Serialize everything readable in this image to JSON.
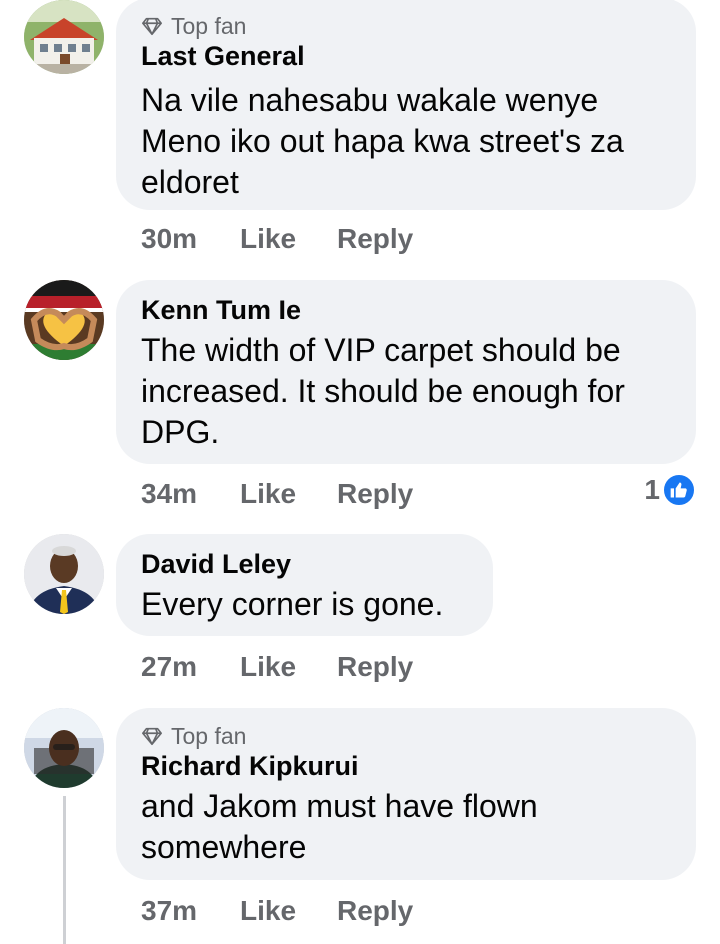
{
  "comments": [
    {
      "badge": "Top fan",
      "author": "Last General",
      "lines": [
        "Na vile nahesabu wakale wenye",
        "Meno iko out hapa kwa street's za",
        "eldoret"
      ],
      "time": "30m",
      "like_label": "Like",
      "reply_label": "Reply"
    },
    {
      "author": "Kenn Tum Ie",
      "lines": [
        "The width of VIP carpet should be",
        "increased. It should be enough for",
        "DPG."
      ],
      "time": "34m",
      "like_label": "Like",
      "reply_label": "Reply",
      "reaction_count": "1",
      "reaction_icon": "like-icon"
    },
    {
      "author": "David Leley",
      "lines": [
        "Every corner is gone."
      ],
      "time": "27m",
      "like_label": "Like",
      "reply_label": "Reply"
    },
    {
      "badge": "Top fan",
      "author": "Richard Kipkurui",
      "lines": [
        "and Jakom must have flown",
        "somewhere"
      ],
      "time": "37m",
      "like_label": "Like",
      "reply_label": "Reply"
    }
  ],
  "colors": {
    "bubble": "#f0f2f5",
    "secondary_text": "#65676b",
    "like_blue": "#1877f2"
  }
}
